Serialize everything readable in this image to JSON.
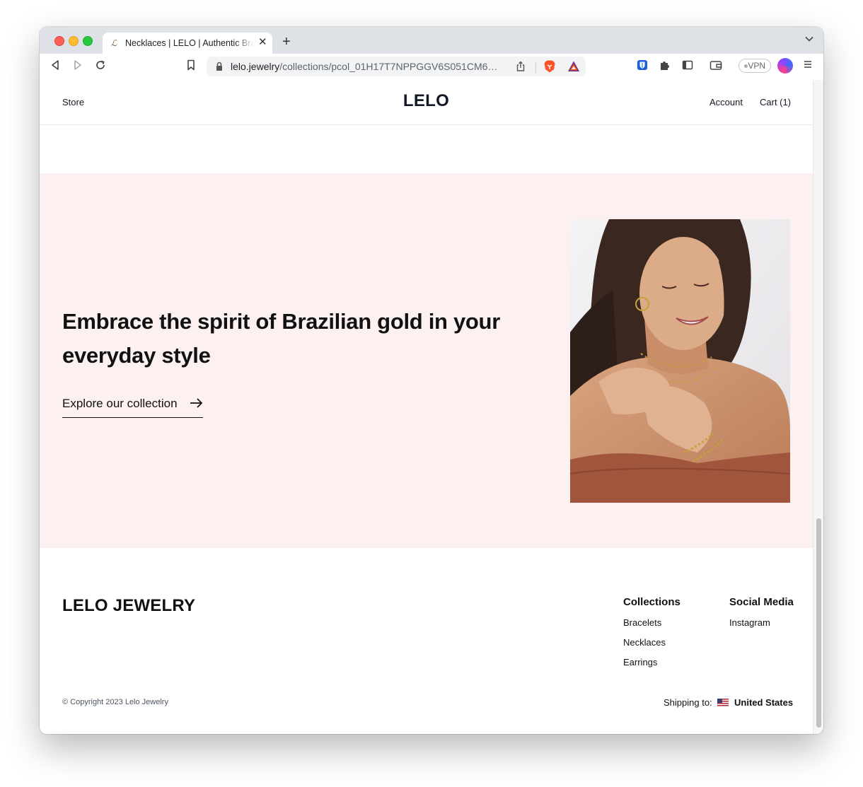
{
  "browser": {
    "tab_title": "Necklaces | LELO | Authentic Brazilian Jewelry",
    "tab_favicon_glyph": "ℒ",
    "new_tab_glyph": "+",
    "close_tab_glyph": "✕",
    "url_host": "lelo.jewelry",
    "url_path": "/collections/pcol_01H17T7NPPGGV6S051CM6…",
    "vpn_label": "VPN"
  },
  "header": {
    "store_label": "Store",
    "logo": "LELO",
    "account_label": "Account",
    "cart_label": "Cart (1)"
  },
  "hero": {
    "title": "Embrace the spirit of Brazilian gold in your everyday style",
    "cta_label": "Explore our collection",
    "background": "#fdf0f0"
  },
  "footer": {
    "brand": "LELO JEWELRY",
    "collections": {
      "title": "Collections",
      "links": [
        "Bracelets",
        "Necklaces",
        "Earrings"
      ]
    },
    "social": {
      "title": "Social Media",
      "links": [
        "Instagram"
      ]
    },
    "copyright": "© Copyright 2023 Lelo Jewelry",
    "shipping_label": "Shipping to:",
    "shipping_country": "United States"
  }
}
